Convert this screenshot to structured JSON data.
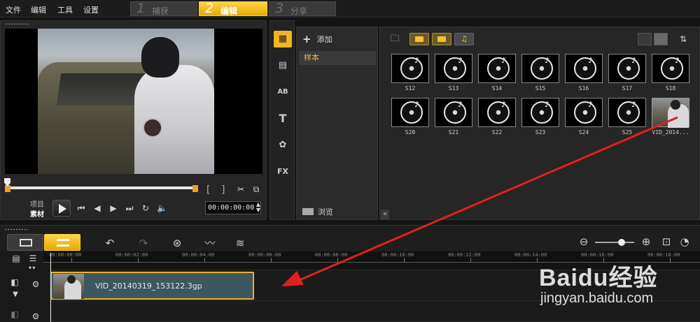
{
  "menu": [
    "文件",
    "编辑",
    "工具",
    "设置"
  ],
  "steps": [
    {
      "num": "1",
      "label": "捕获",
      "active": false
    },
    {
      "num": "2",
      "label": "编辑",
      "active": true
    },
    {
      "num": "3",
      "label": "分享",
      "active": false
    }
  ],
  "preview": {
    "mark_in": "[",
    "mark_out": "]",
    "mode_project": "项目",
    "mode_clip": "素材",
    "timecode": "00:00:00:00"
  },
  "library": {
    "add_label": "添加",
    "folder_selected": "样本",
    "browse_label": "浏览",
    "thumbnails_row1": [
      "S12",
      "S13",
      "S14",
      "S15",
      "S16",
      "S17",
      "S18"
    ],
    "thumbnails_row2": [
      "S20",
      "S21",
      "S22",
      "S23",
      "S24",
      "S25"
    ],
    "video_thumbnail_label": "VID_2014..."
  },
  "timeline": {
    "ruler_labels": [
      "00:00:00:00",
      "00:00:02:00",
      "00:00:04:00",
      "00:00:06:00",
      "00:00:08:00",
      "00:00:10:00",
      "00:00:12:00",
      "00:00:14:00",
      "00:00:16:00",
      "00:00:18:00"
    ],
    "clip_name": "VID_20140319_153122.3gp"
  },
  "watermark": {
    "brand": "Baidu经验",
    "url": "jingyan.baidu.com"
  },
  "colors": {
    "accent": "#f2b420",
    "annotation_arrow": "#e02020",
    "clip_fill": "#3c5760"
  }
}
